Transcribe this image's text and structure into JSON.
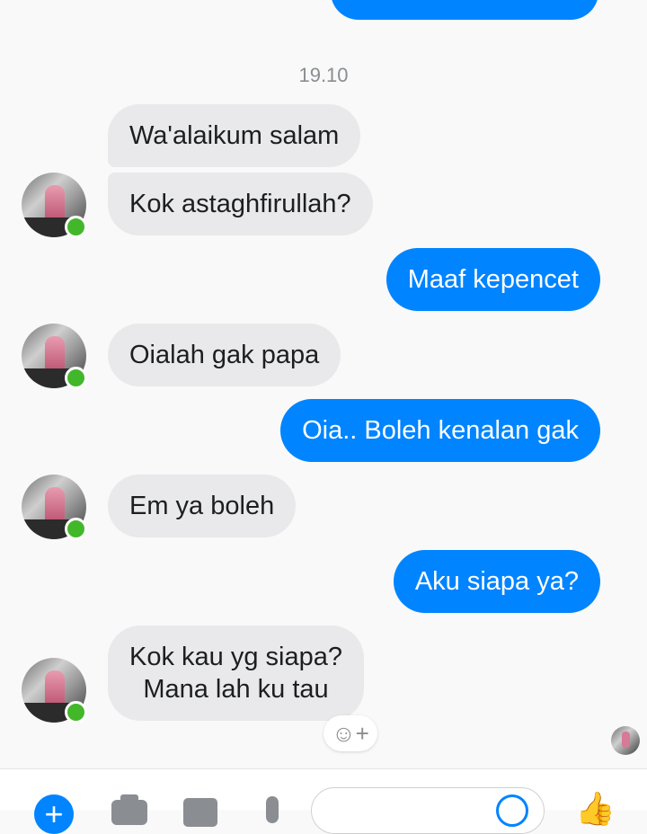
{
  "conversation": {
    "timestamp": "19.10",
    "messages": [
      {
        "sender": "me",
        "text": ""
      },
      {
        "sender": "contact",
        "text": "Wa'alaikum salam"
      },
      {
        "sender": "contact",
        "text": "Kok astaghfirullah?"
      },
      {
        "sender": "me",
        "text": "Maaf kepencet"
      },
      {
        "sender": "contact",
        "text": "Oialah gak papa"
      },
      {
        "sender": "me",
        "text": "Oia.. Boleh kenalan gak"
      },
      {
        "sender": "contact",
        "text": "Em ya boleh"
      },
      {
        "sender": "me",
        "text": "Aku siapa ya?"
      },
      {
        "sender": "contact",
        "lines": [
          "Kok kau yg siapa?",
          "Mana lah ku tau"
        ]
      }
    ],
    "react_icon": "add-reaction-icon",
    "seen_indicator": "seen-avatar"
  },
  "composer": {
    "icons": [
      "plus-icon",
      "camera-icon",
      "gallery-icon",
      "mic-icon",
      "emoji-icon",
      "thumbs-up-icon"
    ]
  },
  "colors": {
    "outgoing_bubble": "#0084ff",
    "incoming_bubble": "#e9e9eb",
    "presence_dot": "#42b72a",
    "background": "#f9f9f9"
  }
}
